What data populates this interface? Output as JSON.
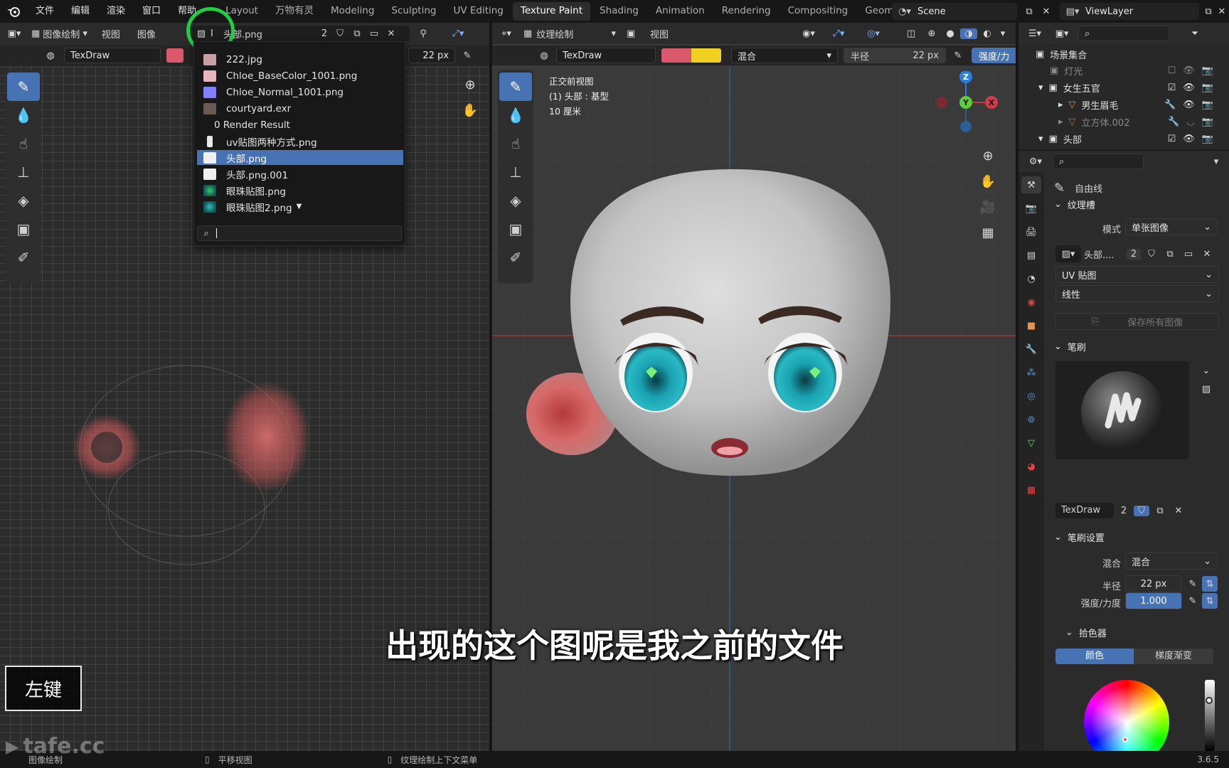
{
  "topbar": {
    "menus": [
      "文件",
      "编辑",
      "渲染",
      "窗口",
      "帮助"
    ],
    "workspaces": [
      "Layout",
      "万物有灵",
      "Modeling",
      "Sculpting",
      "UV Editing",
      "Texture Paint",
      "Shading",
      "Animation",
      "Rendering",
      "Compositing",
      "Geometry Nod"
    ],
    "active_workspace": "Texture Paint",
    "scene_name": "Scene",
    "view_layer": "ViewLayer"
  },
  "image_editor": {
    "mode": "图像绘制",
    "menus": [
      "视图",
      "图像"
    ],
    "image_name": "头部.png",
    "users": "2",
    "brush_name": "TexDraw",
    "radius": "22 px",
    "dropdown": {
      "items": [
        {
          "label": "222.jpg",
          "thumb": "#c9a0a8"
        },
        {
          "label": "Chloe_BaseColor_1001.png",
          "thumb": "#e8b4bd"
        },
        {
          "label": "Chloe_Normal_1001.png",
          "thumb": "#8080ff"
        },
        {
          "label": "courtyard.exr",
          "thumb": "#6a5a52"
        },
        {
          "label": "0 Render Result",
          "thumb": ""
        },
        {
          "label": "uv贴图两种方式.png",
          "thumb": "#e8e8e8"
        },
        {
          "label": "头部.png",
          "thumb": "#f0f0f0",
          "selected": true
        },
        {
          "label": "头部.png.001",
          "thumb": "#f0f0f0"
        },
        {
          "label": "眼珠贴图.png",
          "thumb": "#2a9a6a"
        },
        {
          "label": "眼珠贴图2.png",
          "thumb": "#2a8a8a"
        }
      ],
      "search_placeholder": ""
    }
  },
  "viewport": {
    "mode": "纹理绘制",
    "menu": "视图",
    "brush_name": "TexDraw",
    "blend": "混合",
    "radius_label": "半径",
    "radius": "22 px",
    "strength_label": "强度/力",
    "info": [
      "正交前视图",
      "(1) 头部 : 基型",
      "10 厘米"
    ],
    "gizmo": {
      "z": "Z",
      "y": "Y",
      "x": "X"
    }
  },
  "outliner": {
    "rows": [
      {
        "label": "场景集合"
      },
      {
        "label": "灯光"
      },
      {
        "label": "女生五官"
      },
      {
        "label": "男生眉毛"
      },
      {
        "label": "立方体.002"
      },
      {
        "label": "头部"
      }
    ]
  },
  "properties": {
    "tool_name": "自由线",
    "texture_slots": {
      "title": "纹理槽",
      "mode_label": "模式",
      "mode_value": "单张图像",
      "image_name": "头部....",
      "image_users": "2",
      "mapping": "UV 贴图",
      "interpolation": "线性",
      "save_all": "保存所有图像"
    },
    "brush": {
      "title": "笔刷",
      "name": "TexDraw",
      "users": "2"
    },
    "brush_settings": {
      "title": "笔刷设置",
      "blend_label": "混合",
      "blend_value": "混合",
      "radius_label": "半径",
      "radius_value": "22 px",
      "strength_label": "强度/力度",
      "strength_value": "1.000",
      "strength_fraction": 1.0
    },
    "color_picker": {
      "title": "拾色器",
      "tab_color": "颜色",
      "tab_gradient": "梯度渐变"
    }
  },
  "statusbar": {
    "left": "图像绘制",
    "mid1": "平移视图",
    "mid2": "纹理绘制上下文菜单",
    "version": "3.6.5"
  },
  "overlays": {
    "subtitle": "出现的这个图呢是我之前的文件",
    "key_hint": "左键",
    "watermark": "tafe.cc"
  },
  "colors": {
    "accent": "#4772b3",
    "brush_color_1": "#d9596a",
    "brush_color_2": "#f0d020",
    "highlight_circle": "#22cc44"
  }
}
